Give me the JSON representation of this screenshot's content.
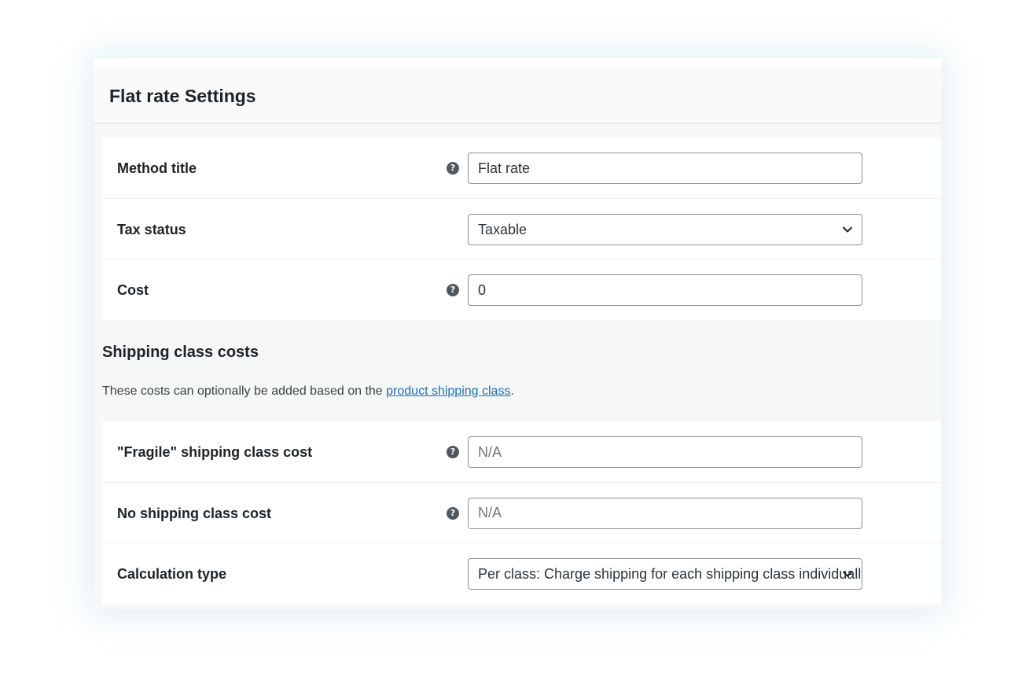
{
  "settings": {
    "title": "Flat rate Settings",
    "fields_top": [
      {
        "label": "Method title",
        "help": true,
        "type": "text",
        "value": "Flat rate",
        "is_placeholder": false
      },
      {
        "label": "Tax status",
        "help": false,
        "type": "select",
        "value": "Taxable",
        "is_placeholder": false
      },
      {
        "label": "Cost",
        "help": true,
        "type": "text",
        "value": "0",
        "is_placeholder": false
      }
    ],
    "shipping_class": {
      "heading": "Shipping class costs",
      "desc_prefix": "These costs can optionally be added based on the ",
      "desc_link": "product shipping class",
      "desc_suffix": "."
    },
    "fields_bottom": [
      {
        "label": "\"Fragile\" shipping class cost",
        "help": true,
        "type": "text",
        "value": "N/A",
        "is_placeholder": true
      },
      {
        "label": "No shipping class cost",
        "help": true,
        "type": "text",
        "value": "N/A",
        "is_placeholder": true
      },
      {
        "label": "Calculation type",
        "help": false,
        "type": "select",
        "value": "Per class: Charge shipping for each shipping class individually",
        "is_placeholder": false
      }
    ],
    "help_glyph": "?",
    "icons": {
      "help": "question-circle-icon",
      "dropdown": "chevron-down-icon"
    }
  }
}
